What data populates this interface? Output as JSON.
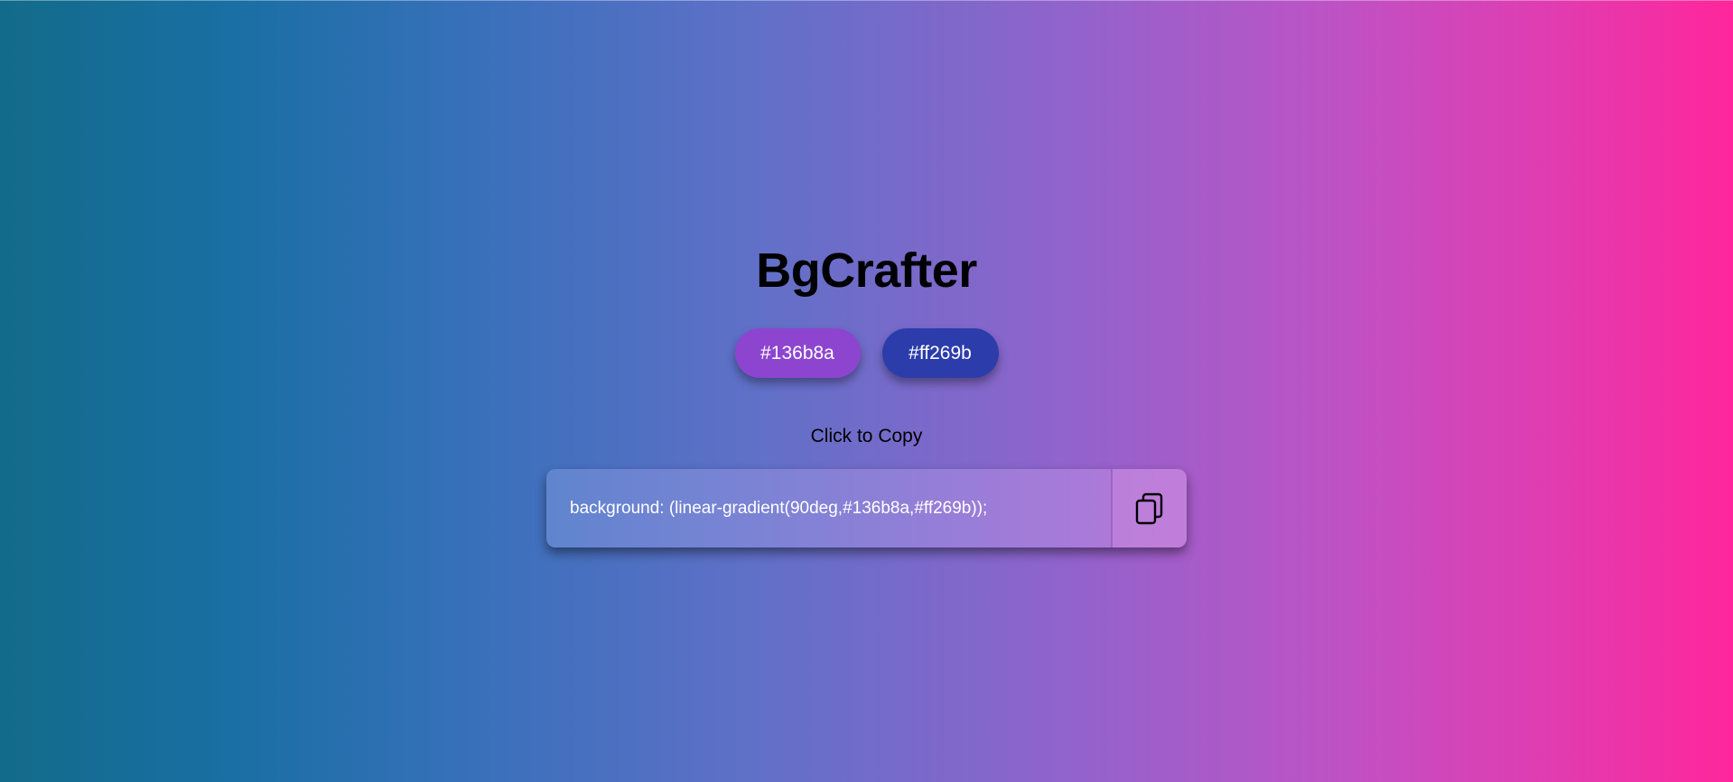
{
  "app": {
    "title": "BgCrafter"
  },
  "colors": {
    "first": {
      "label": "#136b8a",
      "swatch": "#8d45cf"
    },
    "second": {
      "label": "#ff269b",
      "swatch": "#2c3dab"
    }
  },
  "copy": {
    "hint": "Click to Copy",
    "code": "background: (linear-gradient(90deg,#136b8a,#ff269b));",
    "icon": "copy-icon"
  }
}
